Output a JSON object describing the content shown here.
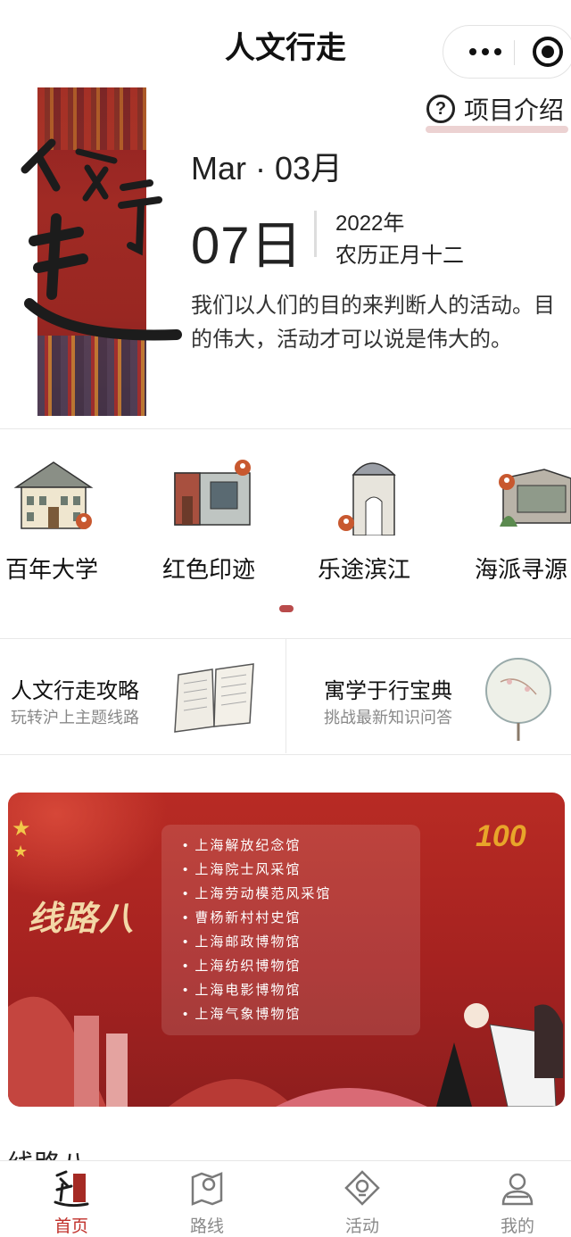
{
  "app": {
    "title": "人文行走"
  },
  "intro": {
    "icon": "question-icon",
    "label": "项目介绍"
  },
  "poster": {
    "calligraphy": "人文行走"
  },
  "date": {
    "month": "Mar · 03月",
    "day": "07日",
    "year": "2022年",
    "lunar": "农历正月十二",
    "quote": "我们以人们的目的来判断人的活动。目的伟大，活动才可以说是伟大的。"
  },
  "themes": [
    {
      "label": "百年大学",
      "icon": "university-building-icon"
    },
    {
      "label": "红色印迹",
      "icon": "red-heritage-house-icon"
    },
    {
      "label": "乐途滨江",
      "icon": "riverside-gate-icon"
    },
    {
      "label": "海派寻源",
      "icon": "shanghai-style-house-icon"
    }
  ],
  "cards": [
    {
      "title": "人文行走攻略",
      "subtitle": "玩转沪上主题线路",
      "icon": "open-book-icon"
    },
    {
      "title": "寓学于行宝典",
      "subtitle": "挑战最新知识问答",
      "icon": "fan-icon"
    }
  ],
  "route_banner": {
    "line_title": "线路八",
    "badge": "100",
    "stops": [
      "上海解放纪念馆",
      "上海院士风采馆",
      "上海劳动模范风采馆",
      "曹杨新村村史馆",
      "上海邮政博物馆",
      "上海纺织博物馆",
      "上海电影博物馆",
      "上海气象博物馆"
    ]
  },
  "section": {
    "title": "线路八"
  },
  "tabbar": [
    {
      "label": "首页",
      "icon": "home-calligraphy-icon",
      "active": true
    },
    {
      "label": "路线",
      "icon": "map-route-icon",
      "active": false
    },
    {
      "label": "活动",
      "icon": "activity-diamond-icon",
      "active": false
    },
    {
      "label": "我的",
      "icon": "profile-icon",
      "active": false
    }
  ],
  "colors": {
    "accent": "#c0302a",
    "banner": "#a52220",
    "indicator": "#b94b4b"
  }
}
